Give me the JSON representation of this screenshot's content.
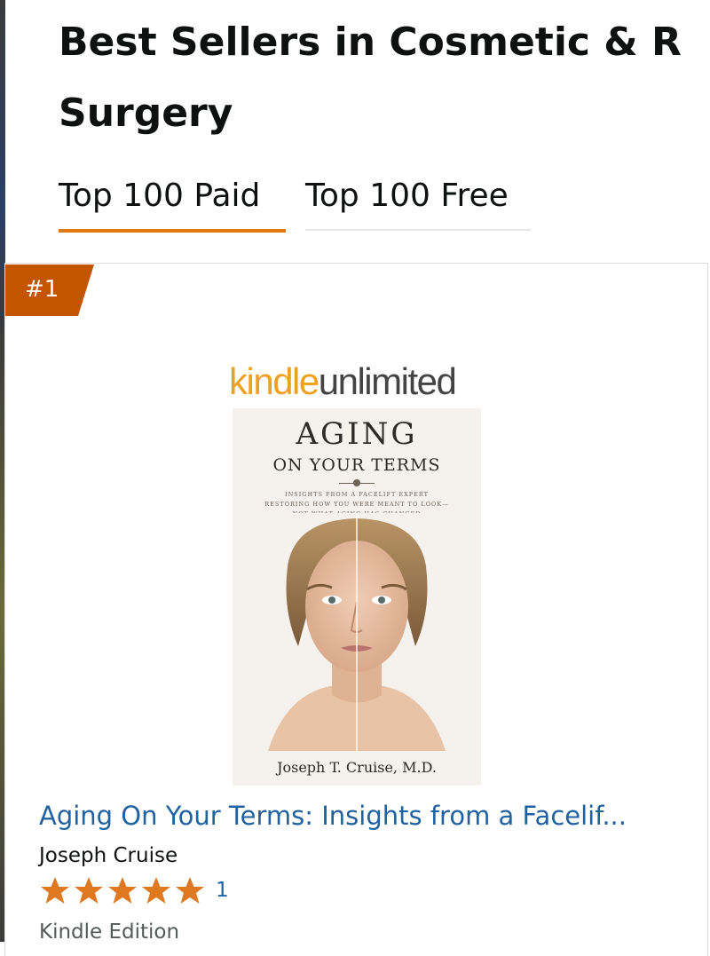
{
  "page": {
    "title_line1": "Best Sellers in Cosmetic & R",
    "title_line2": "Surgery"
  },
  "tabs": [
    {
      "label": "Top 100 Paid",
      "selected": true
    },
    {
      "label": "Top 100 Free",
      "selected": false
    }
  ],
  "item": {
    "rank": "#1",
    "badge_logo": {
      "part1": "kindle",
      "part2": "unlimited"
    },
    "cover": {
      "title": "AGING",
      "subtitle": "ON YOUR TERMS",
      "tagline": "INSIGHTS FROM A FACELIFT EXPERT",
      "tagline2": "RESTORING HOW YOU WERE MEANT TO LOOK—",
      "tagline3": "NOT WHAT AGING HAS CHANGED",
      "author": "Joseph T. Cruise, M.D."
    },
    "title_link": "Aging On Your Terms: Insights from a Facelif...",
    "author": "Joseph Cruise",
    "rating_stars": 5,
    "review_count": "1",
    "format": "Kindle Edition"
  },
  "colors": {
    "accent_orange": "#e47911",
    "rank_badge": "#c45500",
    "link_blue": "#2162a1",
    "star": "#de7921",
    "kindle_orange": "#f0a020"
  }
}
